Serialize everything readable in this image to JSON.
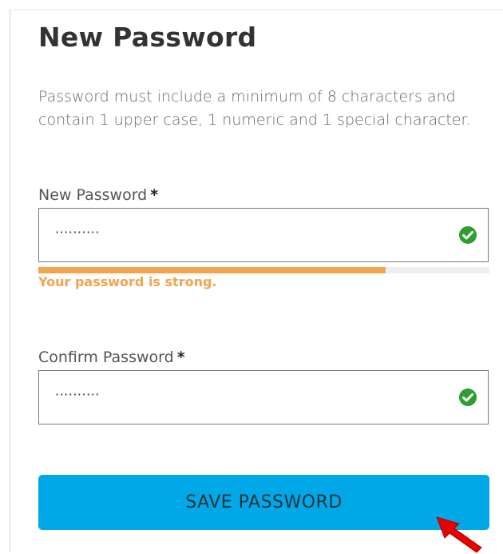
{
  "form": {
    "title": "New Password",
    "hint": "Password must include a minimum of 8 characters and contain 1 upper case, 1 numeric and 1 special character.",
    "new_password": {
      "label": "New Password",
      "required_mark": "*",
      "value": "··········",
      "valid_icon": "check-circle-icon"
    },
    "strength": {
      "level": 0.77,
      "message": "Your password is strong."
    },
    "confirm_password": {
      "label": "Confirm Password",
      "required_mark": "*",
      "value": "··········",
      "valid_icon": "check-circle-icon"
    },
    "save_label": "SAVE PASSWORD"
  },
  "overlay": {
    "cursor_icon": "red-arrow-pointer-icon"
  },
  "colors": {
    "accent": "#00a8e8",
    "strength": "#f2a44e",
    "valid": "#2e9e2e",
    "pointer": "#e60000"
  }
}
